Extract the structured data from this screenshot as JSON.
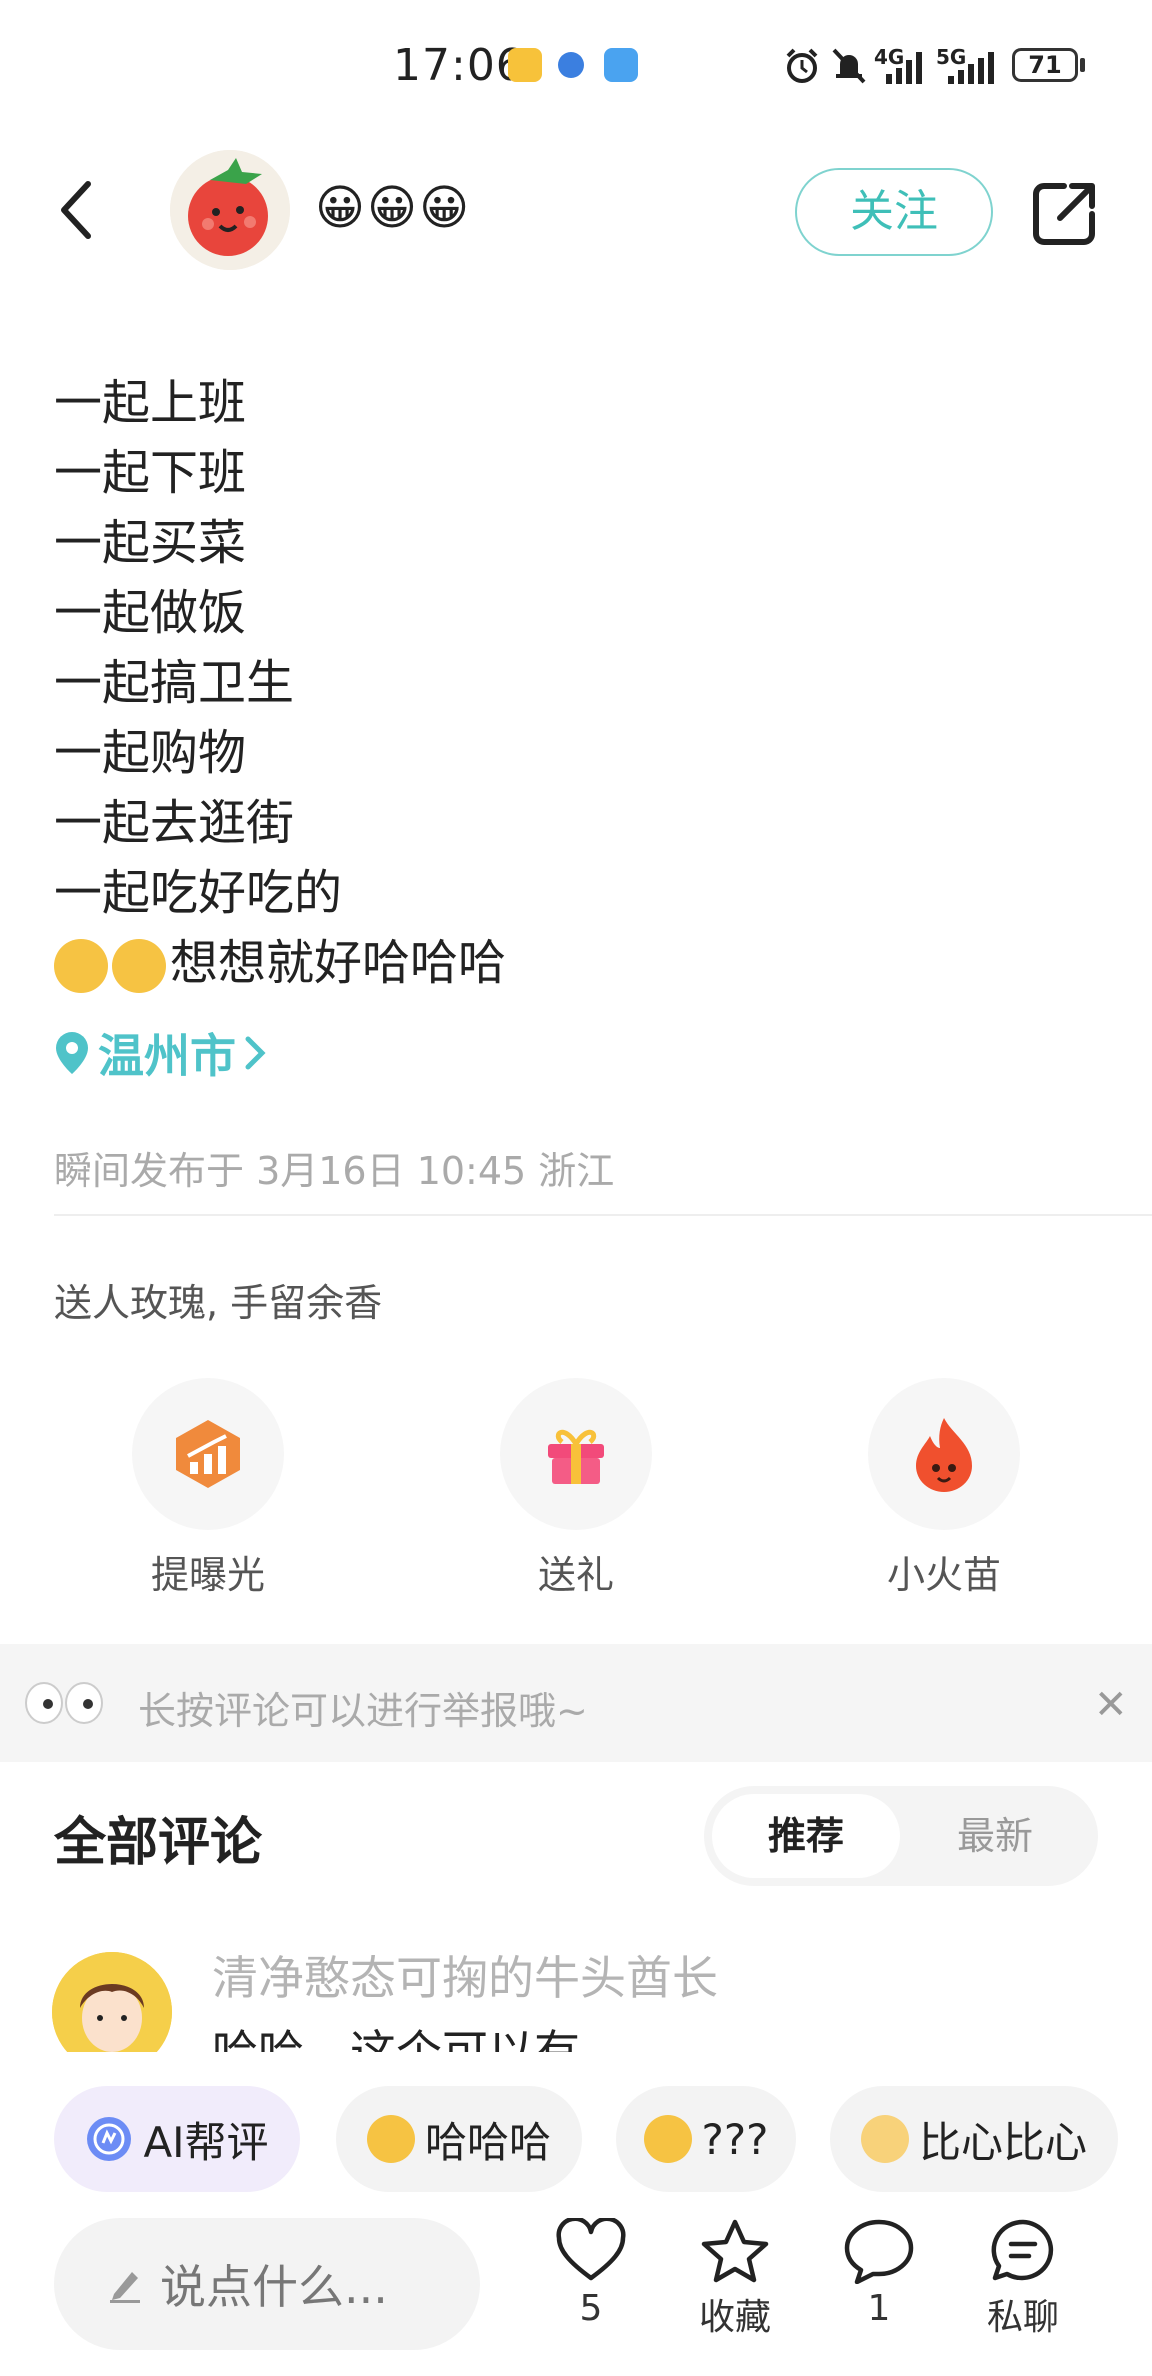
{
  "status_bar": {
    "time": "17:06",
    "network_1": "4G",
    "network_2": "5G",
    "battery": "71"
  },
  "header": {
    "username": "😀😀😀",
    "follow_label": "关注"
  },
  "post": {
    "lines": [
      "一起上班",
      "一起下班",
      "一起买菜",
      "一起做饭",
      "一起搞卫生",
      "一起购物",
      "一起去逛街",
      "一起吃好吃的"
    ],
    "last_line_text": "想想就好哈哈哈",
    "location": "温州市",
    "meta": "瞬间发布于 3月16日 10:45 浙江"
  },
  "gift_section": {
    "title": "送人玫瑰, 手留余香",
    "actions": [
      {
        "label": "提曝光",
        "icon": "boost-icon"
      },
      {
        "label": "送礼",
        "icon": "gift-icon"
      },
      {
        "label": "小火苗",
        "icon": "flame-icon"
      }
    ]
  },
  "tip": {
    "text": "长按评论可以进行举报哦~"
  },
  "comments": {
    "title": "全部评论",
    "tabs": [
      "推荐",
      "最新"
    ],
    "active_tab": "推荐",
    "preview": {
      "author": "清净憨态可掬的牛头酋长",
      "text": "哈哈，这个可以有"
    }
  },
  "quick_replies": [
    {
      "label": "AI帮评",
      "icon": "ai-icon"
    },
    {
      "label": "哈哈哈",
      "icon": "laugh-emoji-icon"
    },
    {
      "label": "???",
      "icon": "thinking-emoji-icon"
    },
    {
      "label": "比心比心",
      "icon": "heart-hand-emoji-icon"
    }
  ],
  "bottom_bar": {
    "input_placeholder": "说点什么...",
    "like_count": "5",
    "favorite_label": "收藏",
    "comment_count": "1",
    "message_label": "私聊"
  },
  "colors": {
    "accent": "#4fc3c9",
    "follow_border": "#7fd3cf",
    "muted_text": "#aaaaaa"
  }
}
